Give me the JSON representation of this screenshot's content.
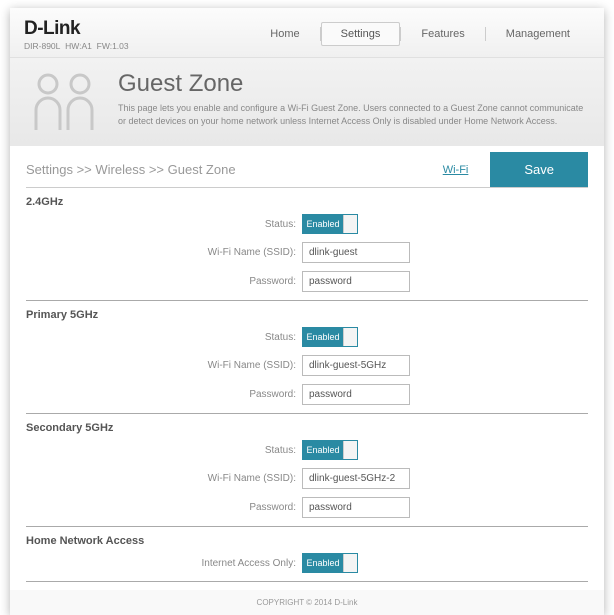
{
  "header": {
    "brand": "D-Link",
    "model": "DIR-890L",
    "hw": "HW:A1",
    "fw": "FW:1.03",
    "nav": {
      "home": "Home",
      "settings": "Settings",
      "features": "Features",
      "management": "Management"
    }
  },
  "hero": {
    "title": "Guest Zone",
    "desc": "This page lets you enable and configure a Wi-Fi Guest Zone. Users connected to a Guest Zone cannot communicate or detect devices on your home network unless Internet Access Only is disabled under Home Network Access."
  },
  "crumbs": {
    "text": "Settings >> Wireless >> Guest Zone",
    "wifi": "Wi-Fi",
    "save": "Save"
  },
  "labels": {
    "status": "Status:",
    "ssid": "Wi-Fi Name (SSID):",
    "password": "Password:",
    "iao": "Internet Access Only:",
    "enabled": "Enabled"
  },
  "sections": {
    "g24": {
      "title": "2.4GHz",
      "ssid": "dlink-guest",
      "password": "password"
    },
    "p5": {
      "title": "Primary 5GHz",
      "ssid": "dlink-guest-5GHz",
      "password": "password"
    },
    "s5": {
      "title": "Secondary 5GHz",
      "ssid": "dlink-guest-5GHz-2",
      "password": "password"
    },
    "hna": {
      "title": "Home Network Access"
    }
  },
  "footer": "COPYRIGHT © 2014 D-Link"
}
